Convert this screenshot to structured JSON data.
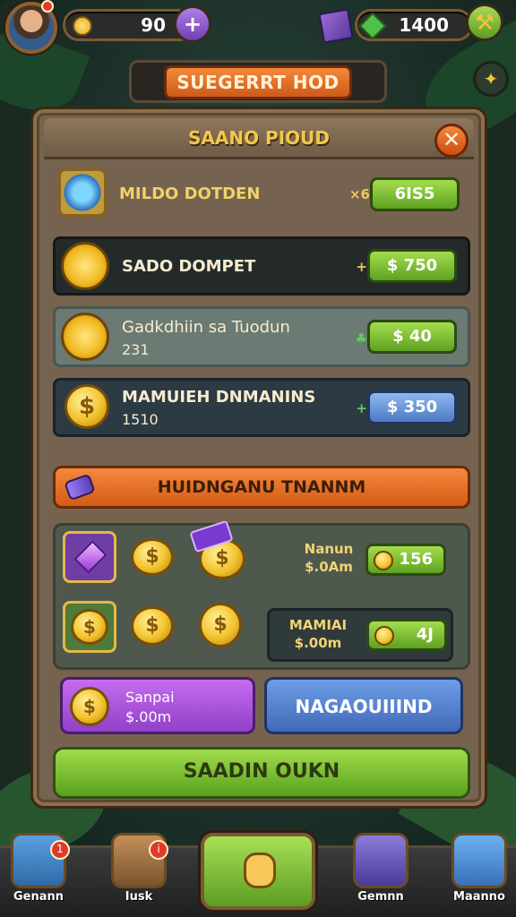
{
  "hud": {
    "coins_value": "90",
    "gems_value": "1400",
    "plus_icon": "plus-icon",
    "settings_icon": "wrench-icon",
    "pin_icon": "pin-icon"
  },
  "title_banner": {
    "label": "SUEGERRT HOD"
  },
  "panel": {
    "title": "SAANO PIOUD",
    "close_label": "✕",
    "rows": [
      {
        "title": "MILDO DOTDEN",
        "subtitle": "",
        "multiplier": "×6",
        "price": "6IS5",
        "icon": "blue-gem-icon"
      },
      {
        "title": "SADO DOMPET",
        "subtitle": "",
        "multiplier": "+",
        "price": "$  750",
        "icon": "sun-coin-icon"
      },
      {
        "title": "Gadkdhiin sa Tuodun",
        "subtitle": "231",
        "multiplier": "",
        "price": "$  40",
        "icon": "sun-coin-icon"
      },
      {
        "title": "MAMUIEH DNMANINS",
        "subtitle": "1510",
        "multiplier": "+",
        "price": "$  350",
        "icon": "gold-coin-icon"
      }
    ]
  },
  "section": {
    "title": "HUIDNGANU TNANNM"
  },
  "shop": {
    "deal1": {
      "label_line1": "Nanun",
      "label_line2": "$.0Am",
      "price": "156"
    },
    "deal2": {
      "label_line1": "MAMIAI",
      "label_line2": "$.00m",
      "price": "4J"
    }
  },
  "cards": {
    "purple": {
      "line1": "Sanpai",
      "line2": "$.00m"
    },
    "blue": {
      "label": "NAGAOUIIIND"
    }
  },
  "cta": {
    "label": "SAADIN OUKN"
  },
  "nav": {
    "items": [
      {
        "label": "Genann",
        "badge": "1"
      },
      {
        "label": "Iusk",
        "badge": "i"
      },
      {
        "label": "",
        "badge": ""
      },
      {
        "label": "Gemnn",
        "badge": ""
      },
      {
        "label": "Maanno",
        "badge": ""
      }
    ]
  },
  "colors": {
    "accent_orange": "#e86a22",
    "accent_green": "#7cc03a",
    "accent_purple": "#a552d8"
  }
}
